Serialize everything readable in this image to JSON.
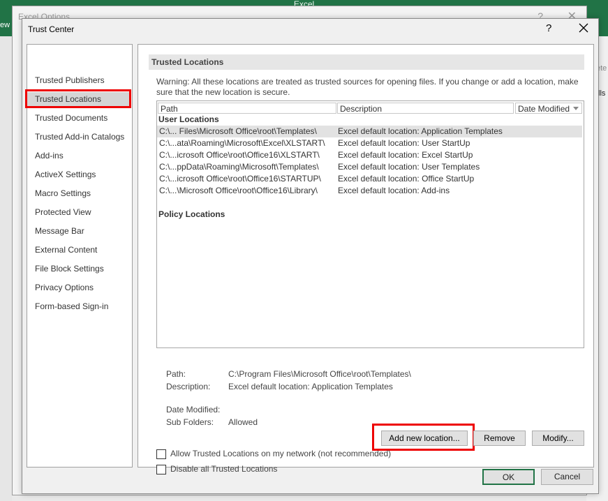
{
  "background": {
    "app_title": "Excel",
    "left_tab_fragment": "ew",
    "options_dialog_title": "Excel Options",
    "options_help": "?",
    "right_fragments": [
      "ete",
      "lls"
    ],
    "accent": "#217346"
  },
  "dialog": {
    "title": "Trust Center",
    "help_label": "?"
  },
  "nav": {
    "items": [
      {
        "label": "Trusted Publishers"
      },
      {
        "label": "Trusted Locations",
        "selected": true
      },
      {
        "label": "Trusted Documents"
      },
      {
        "label": "Trusted Add-in Catalogs"
      },
      {
        "label": "Add-ins"
      },
      {
        "label": "ActiveX Settings"
      },
      {
        "label": "Macro Settings"
      },
      {
        "label": "Protected View"
      },
      {
        "label": "Message Bar"
      },
      {
        "label": "External Content"
      },
      {
        "label": "File Block Settings"
      },
      {
        "label": "Privacy Options"
      },
      {
        "label": "Form-based Sign-in"
      }
    ]
  },
  "main": {
    "section_title": "Trusted Locations",
    "warning": "Warning: All these locations are treated as trusted sources for opening files.  If you change or add a location, make sure that the new location is secure.",
    "columns": {
      "path": "Path",
      "description": "Description",
      "date_modified": "Date Modified"
    },
    "user_locations_header": "User Locations",
    "user_locations": [
      {
        "path": "C:\\... Files\\Microsoft Office\\root\\Templates\\",
        "description": "Excel default location: Application Templates",
        "selected": true
      },
      {
        "path": "C:\\...ata\\Roaming\\Microsoft\\Excel\\XLSTART\\",
        "description": "Excel default location: User StartUp"
      },
      {
        "path": "C:\\...icrosoft Office\\root\\Office16\\XLSTART\\",
        "description": "Excel default location: Excel StartUp"
      },
      {
        "path": "C:\\...ppData\\Roaming\\Microsoft\\Templates\\",
        "description": "Excel default location: User Templates"
      },
      {
        "path": "C:\\...icrosoft Office\\root\\Office16\\STARTUP\\",
        "description": "Excel default location: Office StartUp"
      },
      {
        "path": "C:\\...\\Microsoft Office\\root\\Office16\\Library\\",
        "description": "Excel default location: Add-ins"
      }
    ],
    "policy_locations_header": "Policy Locations",
    "details": {
      "path_label": "Path:",
      "path_value": "C:\\Program Files\\Microsoft Office\\root\\Templates\\",
      "description_label": "Description:",
      "description_value": "Excel default location: Application Templates",
      "date_modified_label": "Date Modified:",
      "date_modified_value": "",
      "subfolders_label": "Sub Folders:",
      "subfolders_value": "Allowed"
    },
    "buttons": {
      "add": "Add new location...",
      "remove": "Remove",
      "modify": "Modify..."
    },
    "checkboxes": {
      "allow_network": "Allow Trusted Locations on my network (not recommended)",
      "disable_all": "Disable all Trusted Locations"
    }
  },
  "footer": {
    "ok": "OK",
    "cancel": "Cancel"
  },
  "colors": {
    "highlight_red": "#e00000",
    "excel_green": "#217346"
  }
}
